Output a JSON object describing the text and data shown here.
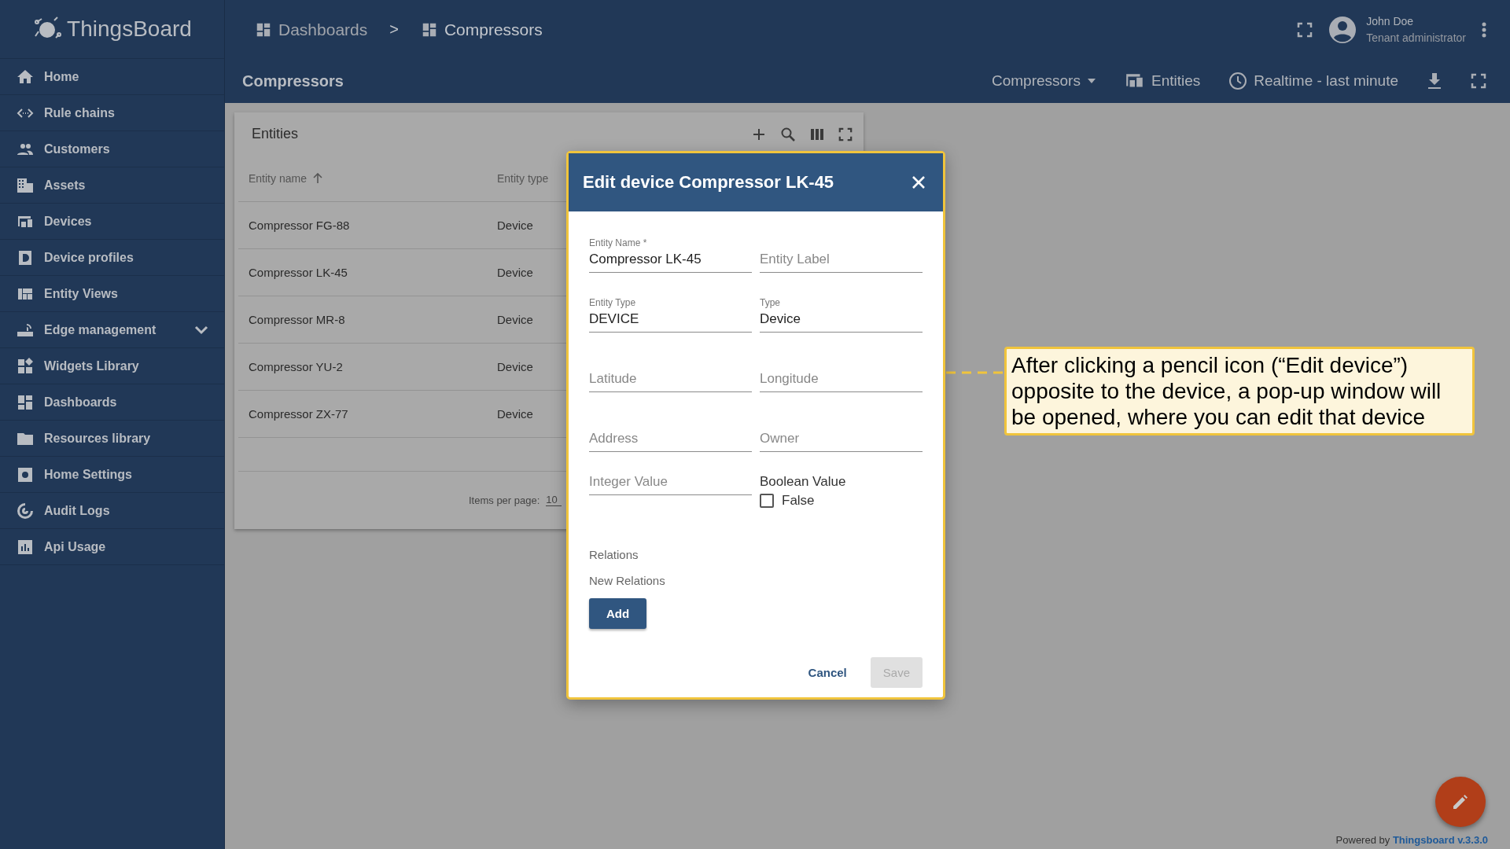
{
  "brand": "ThingsBoard",
  "breadcrumbs": [
    {
      "label": "Dashboards",
      "current": false
    },
    {
      "label": "Compressors",
      "current": true
    }
  ],
  "separator": ">",
  "user": {
    "name": "John Doe",
    "role": "Tenant administrator"
  },
  "sidebar": {
    "items": [
      {
        "label": "Home",
        "has_submenu": false
      },
      {
        "label": "Rule chains",
        "has_submenu": false
      },
      {
        "label": "Customers",
        "has_submenu": false
      },
      {
        "label": "Assets",
        "has_submenu": false
      },
      {
        "label": "Devices",
        "has_submenu": false
      },
      {
        "label": "Device profiles",
        "has_submenu": false
      },
      {
        "label": "Entity Views",
        "has_submenu": false
      },
      {
        "label": "Edge management",
        "has_submenu": true
      },
      {
        "label": "Widgets Library",
        "has_submenu": false
      },
      {
        "label": "Dashboards",
        "has_submenu": false
      },
      {
        "label": "Resources library",
        "has_submenu": false
      },
      {
        "label": "Home Settings",
        "has_submenu": false
      },
      {
        "label": "Audit Logs",
        "has_submenu": false
      },
      {
        "label": "Api Usage",
        "has_submenu": false
      }
    ]
  },
  "dashboard": {
    "title": "Compressors",
    "state_select": "Compressors",
    "entities_button": "Entities",
    "timewindow": "Realtime - last minute"
  },
  "widget": {
    "title": "Entities",
    "columns": [
      {
        "label": "Entity name",
        "sorted": true
      },
      {
        "label": "Entity type",
        "sorted": false
      }
    ],
    "rows": [
      {
        "name": "Compressor FG-88",
        "type": "Device"
      },
      {
        "name": "Compressor LK-45",
        "type": "Device"
      },
      {
        "name": "Compressor MR-8",
        "type": "Device"
      },
      {
        "name": "Compressor YU-2",
        "type": "Device"
      },
      {
        "name": "Compressor ZX-77",
        "type": "Device"
      }
    ],
    "items_per_page_label": "Items per page:",
    "items_per_page": "10"
  },
  "dialog": {
    "title": "Edit device Compressor LK-45",
    "fields": [
      {
        "kind": "text",
        "label": "Entity Name *",
        "value": "Compressor LK-45"
      },
      {
        "kind": "text",
        "placeholder": "Entity Label"
      },
      {
        "kind": "text",
        "label": "Entity Type",
        "value": "DEVICE"
      },
      {
        "kind": "text",
        "label": "Type",
        "value": "Device"
      },
      {
        "kind": "text",
        "placeholder": "Latitude"
      },
      {
        "kind": "text",
        "placeholder": "Longitude"
      },
      {
        "kind": "text",
        "placeholder": "Address"
      },
      {
        "kind": "text",
        "placeholder": "Owner"
      },
      {
        "kind": "text",
        "placeholder": "Integer Value"
      },
      {
        "kind": "checkbox",
        "label": "Boolean Value",
        "text": "False",
        "checked": false
      }
    ],
    "relations_label": "Relations",
    "new_relations_label": "New Relations",
    "add_button": "Add",
    "buttons": [
      {
        "label": "Cancel",
        "disabled": false
      },
      {
        "label": "Save",
        "disabled": true
      }
    ]
  },
  "callout": "After clicking a pencil icon (“Edit device”) opposite to the device, a pop-up window will be opened, where you can edit that device",
  "footer": {
    "prefix": "Powered by",
    "link": "Thingsboard v.3.3.0"
  }
}
